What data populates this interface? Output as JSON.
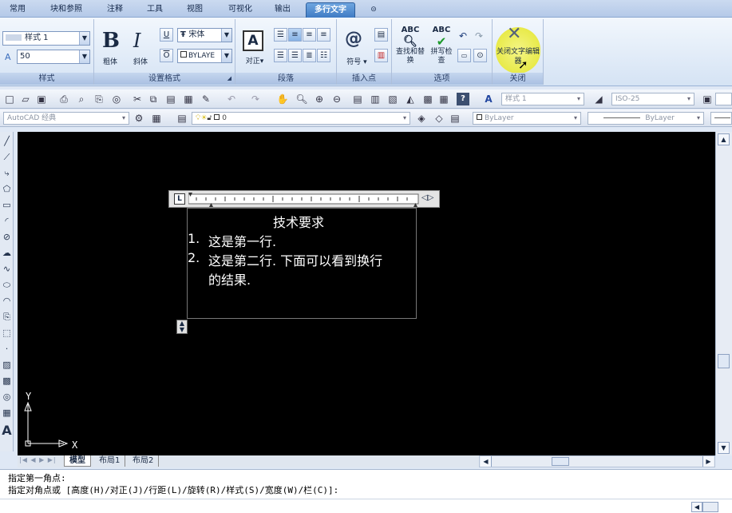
{
  "tabs": [
    "常用",
    "块和参照",
    "注释",
    "工具",
    "视图",
    "可视化",
    "输出",
    "多行文字"
  ],
  "ribbon": {
    "style_panel": {
      "title": "样式",
      "style_name": "样式 1",
      "height_value": "50"
    },
    "format_panel": {
      "title": "设置格式",
      "bold_label": "粗体",
      "italic_label": "斜体",
      "font_value": "宋体",
      "color_value": "BYLAYE"
    },
    "paragraph_panel": {
      "title": "段落",
      "justify_label": "对正"
    },
    "insert_panel": {
      "title": "插入点",
      "symbol_label": "符号"
    },
    "options_panel": {
      "title": "选项",
      "find_replace_label": "查找和替换",
      "spell_check_label": "拼写检查"
    },
    "close_panel": {
      "title": "关闭",
      "close_editor_label": "关闭文字编辑器"
    }
  },
  "toolbar1": {
    "text_style": "样式 1",
    "dim_style": "ISO-25"
  },
  "toolbar2": {
    "workspace": "AutoCAD 经典",
    "layer": "0",
    "color": "ByLayer",
    "linetype": "ByLayer"
  },
  "canvas": {
    "mtext_lines": [
      "技术要求",
      "1.",
      "这是第一行.",
      "2.",
      "这是第二行. 下面可以看到换行",
      "的结果."
    ],
    "axis_x": "X",
    "axis_y": "Y"
  },
  "layout_tabs": [
    "模型",
    "布局1",
    "布局2"
  ],
  "command": {
    "line1": "指定第一角点:",
    "line2": "指定对角点或 [高度(H)/对正(J)/行距(L)/旋转(R)/样式(S)/宽度(W)/栏(C)]:"
  },
  "colors": {
    "canvas": "#000000",
    "accent": "#3f7bc4",
    "highlight": "#f2f070"
  }
}
